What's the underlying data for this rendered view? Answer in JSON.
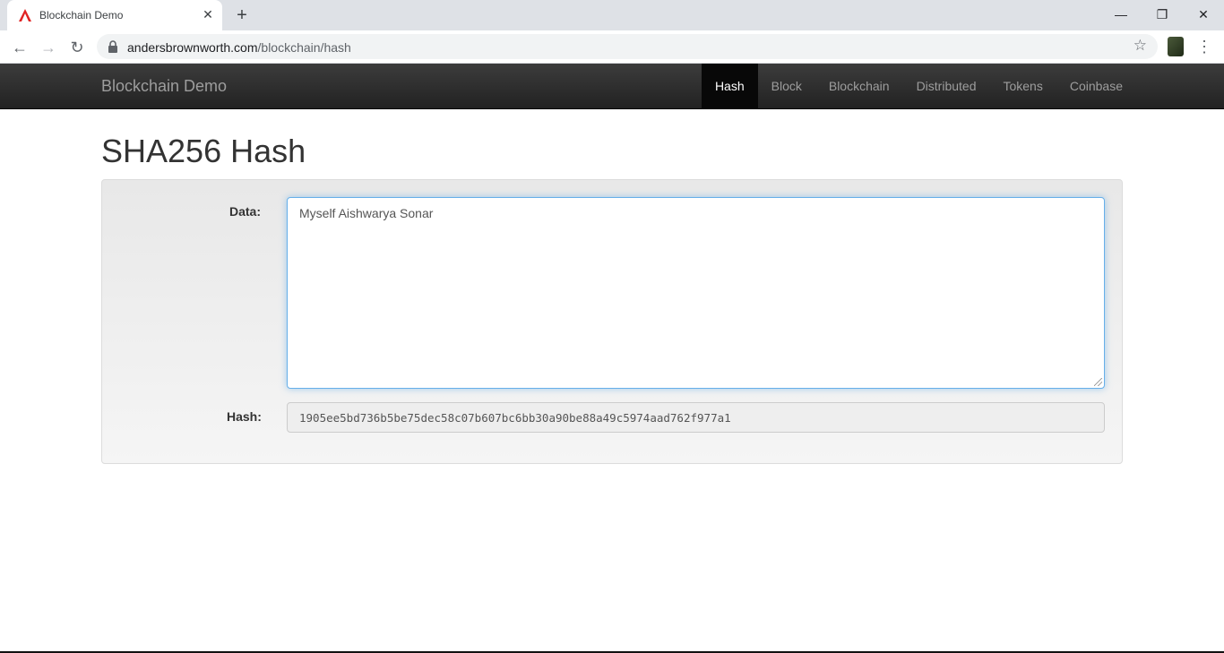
{
  "browser": {
    "tab_title": "Blockchain Demo",
    "url_domain": "andersbrownworth.com",
    "url_path": "/blockchain/hash"
  },
  "navbar": {
    "brand": "Blockchain Demo",
    "links": [
      "Hash",
      "Block",
      "Blockchain",
      "Distributed",
      "Tokens",
      "Coinbase"
    ],
    "active": "Hash"
  },
  "page": {
    "title": "SHA256 Hash",
    "data_label": "Data:",
    "data_value": "Myself Aishwarya Sonar",
    "hash_label": "Hash:",
    "hash_value": "1905ee5bd736b5be75dec58c07b607bc6bb30a90be88a49c5974aad762f977a1"
  },
  "colors": {
    "navbar": "#222222",
    "focus": "#66afe9",
    "favicon": "#e02424"
  }
}
